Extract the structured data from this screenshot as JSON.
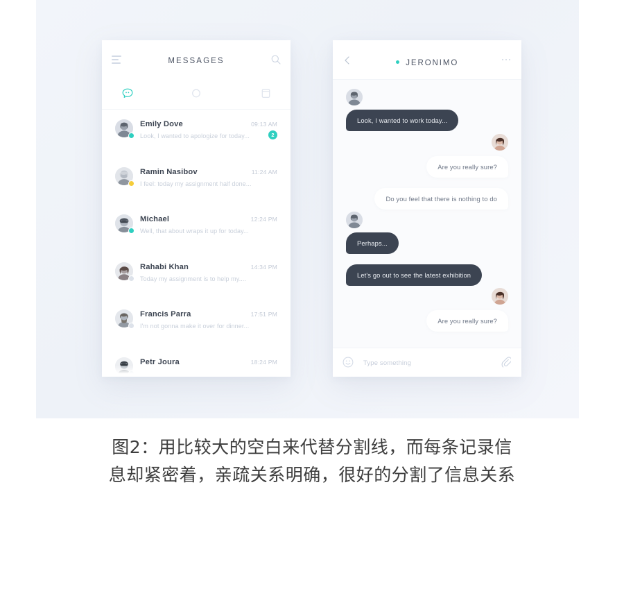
{
  "stage": {
    "background_color": "#f1f4f9",
    "accent_color": "#2ecfc0",
    "dark_bubble_color": "#3c4452"
  },
  "messages_panel": {
    "menu_icon": "hamburger-icon",
    "title": "MESSAGES",
    "search_icon": "search-icon",
    "tabs": [
      {
        "name": "chats",
        "icon": "chat-bubble-icon",
        "active": true
      },
      {
        "name": "pending",
        "icon": "circle-clock-icon",
        "active": false
      },
      {
        "name": "archive",
        "icon": "trash-box-icon",
        "active": false
      }
    ],
    "conversations": [
      {
        "name": "Emily Dove",
        "time": "09:13 AM",
        "preview": "Look, I wanted to apologize for today...",
        "badge": "2",
        "presence": "#2ecfc0"
      },
      {
        "name": "Ramin Nasibov",
        "time": "11:24 AM",
        "preview": "I feel: today my assignment half done...",
        "badge": "",
        "presence": "#f5cd3a"
      },
      {
        "name": "Michael",
        "time": "12:24 PM",
        "preview": "Well, that about wraps it up for today...",
        "badge": "",
        "presence": "#2ecfc0"
      },
      {
        "name": "Rahabi Khan",
        "time": "14:34 PM",
        "preview": "Today my assignment is to help my....",
        "badge": "",
        "presence": "#dde2ea"
      },
      {
        "name": "Francis Parra",
        "time": "17:51 PM",
        "preview": "I'm not gonna make it over for dinner...",
        "badge": "",
        "presence": "#dde2ea"
      },
      {
        "name": "Petr Joura",
        "time": "18:24 PM",
        "preview": "",
        "badge": "",
        "presence": "#dde2ea"
      }
    ]
  },
  "chat_panel": {
    "back_icon": "chevron-left-icon",
    "online_indicator_color": "#2ecfc0",
    "title": "JERONIMO",
    "more_icon": "ellipsis-icon",
    "messages": [
      {
        "side": "left",
        "text": "Look, I wanted to work today...",
        "avatar": true
      },
      {
        "side": "right",
        "text": "Are you really sure?",
        "avatar": true
      },
      {
        "side": "right",
        "text": "Do you feel that there is nothing to do",
        "avatar": false
      },
      {
        "side": "left",
        "text": "Perhaps...",
        "avatar": true
      },
      {
        "side": "left",
        "text": "Let's go out to see the latest exhibition",
        "avatar": false
      },
      {
        "side": "right",
        "text": "Are you really sure?",
        "avatar": true
      }
    ],
    "composer": {
      "emoji_icon": "smiley-icon",
      "placeholder": "Type something",
      "attach_icon": "paperclip-icon"
    }
  },
  "caption": {
    "line1": "图2：用比较大的空白来代替分割线，而每条记录信",
    "line2": "息却紧密着，亲疏关系明确，很好的分割了信息关系"
  }
}
